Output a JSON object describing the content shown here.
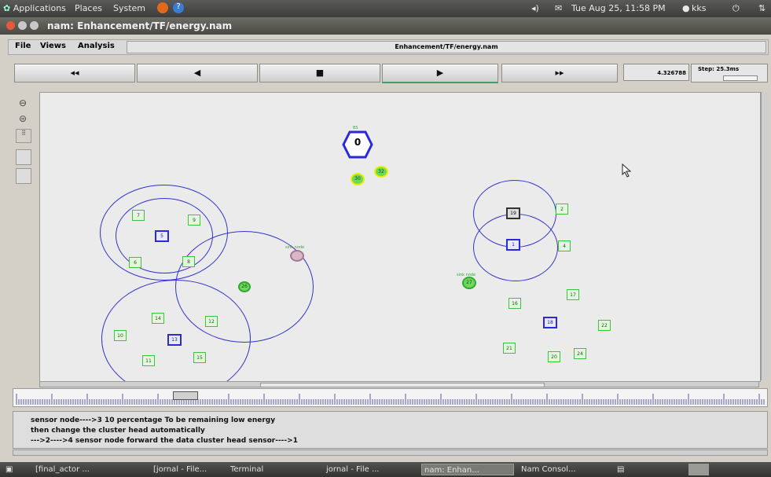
{
  "panel": {
    "menus": [
      "Applications",
      "Places",
      "System"
    ],
    "clock": "Tue Aug 25, 11:58 PM",
    "user": "kks"
  },
  "window": {
    "title": "nam: Enhancement/TF/energy.nam"
  },
  "menubar": {
    "items": [
      "File",
      "Views",
      "Analysis"
    ],
    "file_path": "Enhancement/TF/energy.nam"
  },
  "transport": {
    "rewind": "◂◂",
    "back": "◀",
    "stop": "■",
    "play": "▶",
    "fast_forward": "▸▸",
    "time": "4.326788",
    "step": "Step: 25.3ms"
  },
  "nodes": {
    "base": "0",
    "n2": "2",
    "n3": "3",
    "n4": "4",
    "n5": "5",
    "n6": "6",
    "n7": "7",
    "n8": "8",
    "n9": "9",
    "n10": "10",
    "n11": "11",
    "n12": "12",
    "n13": "13",
    "n14": "14",
    "n15": "15",
    "n16": "16",
    "n17": "17",
    "n18": "18",
    "n19": "19",
    "n20": "20",
    "n21": "21",
    "n22": "22",
    "n24": "24",
    "n26": "26",
    "n27": "27",
    "n30": "30",
    "n32": "32"
  },
  "node_labels": {
    "base_label": "BS",
    "pink_label": "sink node",
    "right_label": "sink node"
  },
  "annotation": {
    "lines": [
      "sensor node---->3 10 percentage To be remaining low energy",
      "then change the cluster head automatically",
      "--->2---->4 sensor node forward the data cluster head sensor---->1"
    ]
  },
  "taskbar": {
    "tasks": [
      "[final_actor ...",
      "[jornal - File...",
      "Terminal",
      "jornal - File ...",
      "nam: Enhan...",
      "Nam Consol..."
    ]
  },
  "colors": {
    "cluster_ring": "#3333cc",
    "sensor_node": "#3cc43c",
    "cluster_head": "#2a2ad8"
  }
}
